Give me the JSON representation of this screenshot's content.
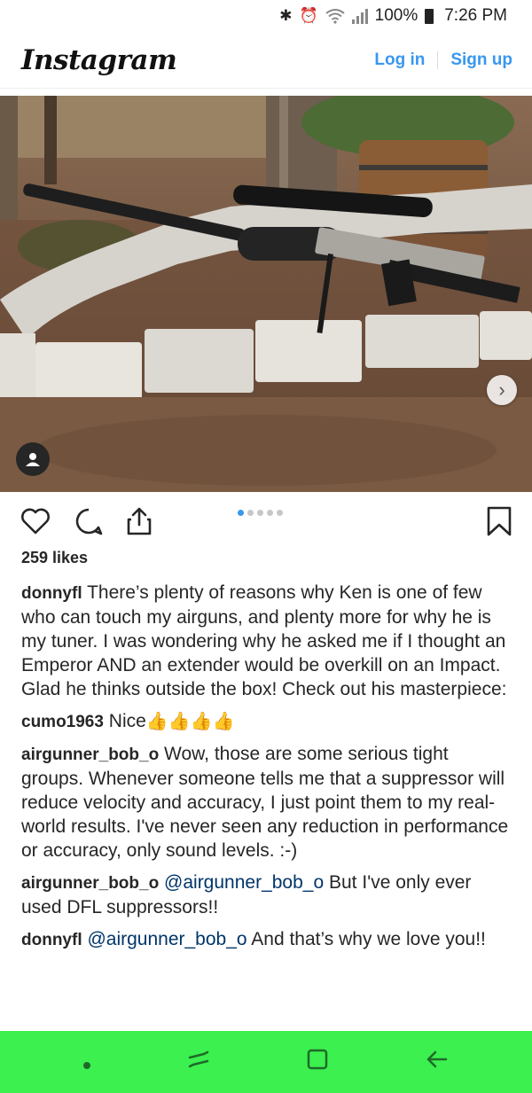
{
  "status_bar": {
    "bluetooth_icon": "bluetooth-icon",
    "alarm_icon": "alarm-icon",
    "wifi_icon": "wifi-icon",
    "signal_icon": "signal-icon",
    "battery": "100%",
    "time": "7:26 PM"
  },
  "header": {
    "logo": "Instagram",
    "login_label": "Log in",
    "signup_label": "Sign up"
  },
  "post": {
    "carousel_position": 1,
    "carousel_total": 5,
    "likes": "259 likes",
    "caption": {
      "username": "donnyfl",
      "text": "There’s plenty of reasons why Ken is one of few who can touch my airguns, and plenty more for why he is my tuner. I was wondering why he asked me if I thought an Emperor AND an extender would be overkill on an Impact. Glad he thinks outside the box! Check out his masterpiece:"
    },
    "comments": [
      {
        "username": "cumo1963",
        "text": "Nice",
        "emoji": "👍👍👍👍"
      },
      {
        "username": "airgunner_bob_o",
        "text": "Wow, those are some serious tight groups. Whenever someone tells me that a suppressor will reduce velocity and accuracy, I just point them to my real-world results. I've never seen any reduction in performance or accuracy, only sound levels. :-)"
      },
      {
        "username": "airgunner_bob_o",
        "mention": "@airgunner_bob_o",
        "text": "But I've only ever used DFL suppressors!!"
      },
      {
        "username": "donnyfl",
        "mention": "@airgunner_bob_o",
        "text": "And that’s why we love you!!"
      }
    ]
  },
  "colors": {
    "accent": "#3897f0",
    "nav_bar": "#3bf04f"
  }
}
